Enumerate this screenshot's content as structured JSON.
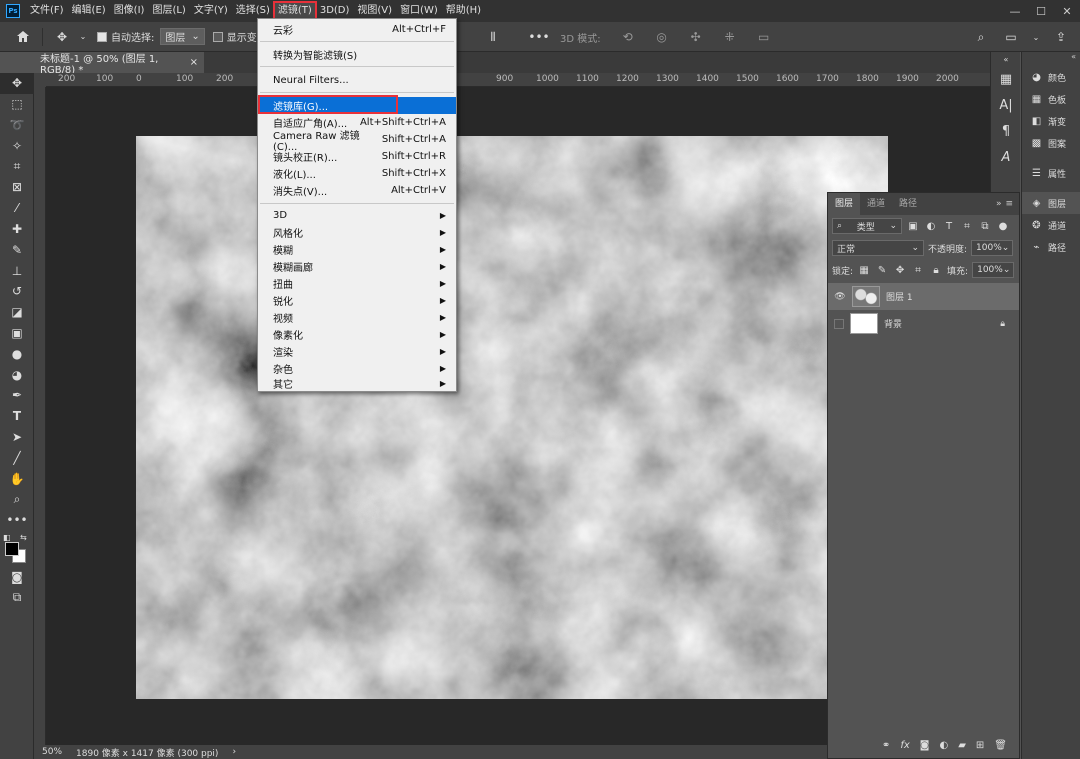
{
  "app": {
    "logo": "Ps",
    "menus": [
      "文件(F)",
      "编辑(E)",
      "图像(I)",
      "图层(L)",
      "文字(Y)",
      "选择(S)",
      "滤镜(T)",
      "3D(D)",
      "视图(V)",
      "窗口(W)",
      "帮助(H)"
    ],
    "active_menu_index": 6
  },
  "options_bar": {
    "auto_select_label": "自动选择:",
    "auto_select_value": "图层",
    "show_transform_label": "显示变",
    "mode_3d_label": "3D 模式:"
  },
  "document": {
    "tab_title": "未标题-1 @ 50% (图层 1, RGB/8) *",
    "zoom": "50%",
    "size_info": "1890 像素 x 1417 像素 (300 ppi)"
  },
  "rulers": {
    "h_labels": [
      "200",
      "100",
      "0",
      "100",
      "200",
      "900",
      "1000",
      "1100",
      "1200",
      "1300",
      "1400",
      "1500",
      "1600",
      "1700",
      "1800",
      "1900",
      "2000"
    ]
  },
  "filter_menu": {
    "items": [
      {
        "label": "云彩",
        "shortcut": "Alt+Ctrl+F"
      },
      {
        "label": "转换为智能滤镜(S)",
        "shortcut": ""
      },
      {
        "label": "Neural Filters...",
        "shortcut": ""
      },
      {
        "label": "滤镜库(G)...",
        "shortcut": ""
      },
      {
        "label": "自适应广角(A)...",
        "shortcut": "Alt+Shift+Ctrl+A"
      },
      {
        "label": "Camera Raw 滤镜(C)...",
        "shortcut": "Shift+Ctrl+A"
      },
      {
        "label": "镜头校正(R)...",
        "shortcut": "Shift+Ctrl+R"
      },
      {
        "label": "液化(L)...",
        "shortcut": "Shift+Ctrl+X"
      },
      {
        "label": "消失点(V)...",
        "shortcut": "Alt+Ctrl+V"
      },
      {
        "label": "3D",
        "shortcut": ""
      },
      {
        "label": "风格化",
        "shortcut": ""
      },
      {
        "label": "模糊",
        "shortcut": ""
      },
      {
        "label": "模糊画廊",
        "shortcut": ""
      },
      {
        "label": "扭曲",
        "shortcut": ""
      },
      {
        "label": "锐化",
        "shortcut": ""
      },
      {
        "label": "视频",
        "shortcut": ""
      },
      {
        "label": "像素化",
        "shortcut": ""
      },
      {
        "label": "渲染",
        "shortcut": ""
      },
      {
        "label": "杂色",
        "shortcut": ""
      },
      {
        "label": "其它",
        "shortcut": ""
      }
    ],
    "highlighted_index": 3
  },
  "right_panels": {
    "items": [
      "颜色",
      "色板",
      "渐变",
      "图案",
      "属性",
      "图层",
      "通道",
      "路径"
    ]
  },
  "layers_panel": {
    "tabs": [
      "图层",
      "通道",
      "路径"
    ],
    "filter_label": "类型",
    "blend_mode": "正常",
    "opacity_label": "不透明度:",
    "opacity_value": "100%",
    "lock_label": "锁定:",
    "fill_label": "填充:",
    "fill_value": "100%",
    "layers": [
      {
        "name": "图层 1",
        "selected": true
      },
      {
        "name": "背景",
        "selected": false
      }
    ]
  },
  "colors": {
    "menu_highlight": "#0a6fd6",
    "annotation_red": "#e8313a",
    "panel_bg": "#535353",
    "chrome_bg": "#424242"
  }
}
